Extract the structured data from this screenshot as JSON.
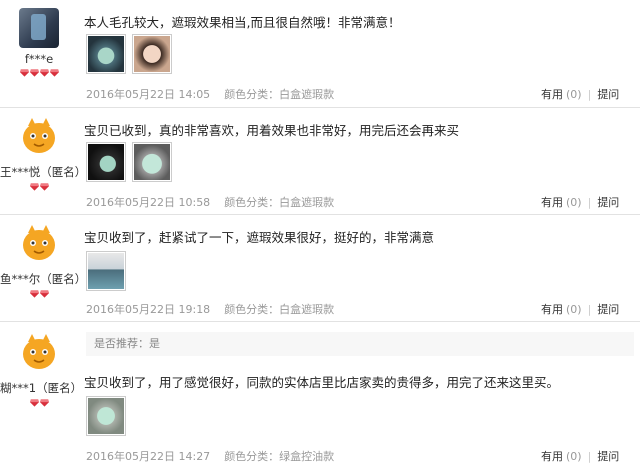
{
  "reviews": [
    {
      "user": "f***e",
      "anonymous": "",
      "gem_count": 4,
      "content": "本人毛孔较大，遮瑕效果相当,而且很自然哦！非常满意！",
      "date": "2016年05月22日 14:05",
      "color_label": "颜色分类：白盒遮瑕款",
      "useful_label": "有用",
      "useful_count": "(0)",
      "ask_label": "提问"
    },
    {
      "user": "王***悦（匿名）",
      "anonymous": "",
      "gem_count": 2,
      "content": "宝贝已收到，真的非常喜欢，用着效果也非常好，用完后还会再来买",
      "date": "2016年05月22日 10:58",
      "color_label": "颜色分类：白盒遮瑕款",
      "useful_label": "有用",
      "useful_count": "(0)",
      "ask_label": "提问"
    },
    {
      "user": "鱼***尔（匿名）",
      "anonymous": "",
      "gem_count": 2,
      "content": "宝贝收到了，赶紧试了一下，遮瑕效果很好，挺好的，非常满意",
      "date": "2016年05月22日 19:18",
      "color_label": "颜色分类：白盒遮瑕款",
      "useful_label": "有用",
      "useful_count": "(0)",
      "ask_label": "提问"
    },
    {
      "user": "糊***1（匿名）",
      "anonymous": "",
      "gem_count": 2,
      "recommend": "是否推荐：是",
      "content": "宝贝收到了，用了感觉很好，同款的实体店里比店家卖的贵得多，用完了还来这里买。",
      "date": "2016年05月22日 14:27",
      "color_label": "颜色分类：绿盒控油款",
      "useful_label": "有用",
      "useful_count": "(0)",
      "ask_label": "提问"
    }
  ],
  "colors": {
    "gem": "#d8303c",
    "avatar_bg": "#f5a623",
    "meta": "#999999"
  },
  "icons": {
    "avatar_default": "orange-cartoon-avatar-icon",
    "gem": "red-diamond-icon"
  }
}
